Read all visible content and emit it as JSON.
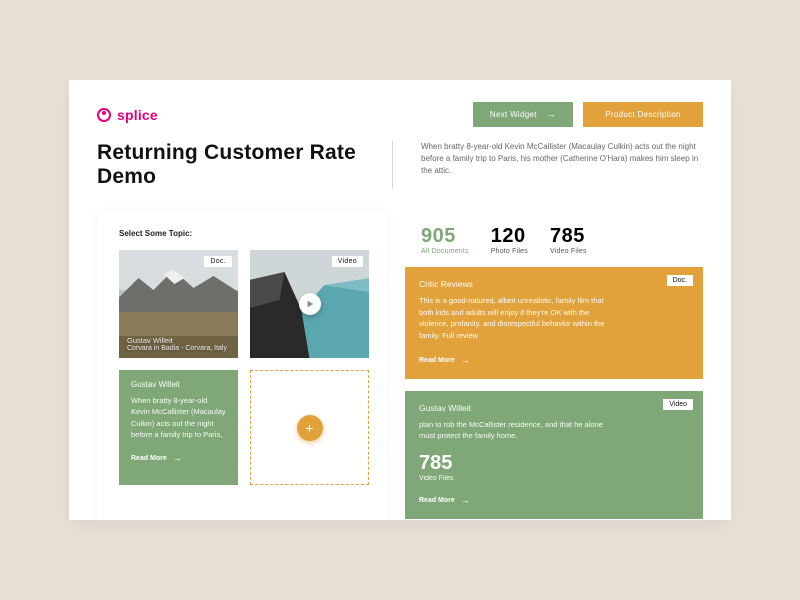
{
  "brand": {
    "name": "splice"
  },
  "toolbar": {
    "next_label": "Next Widget",
    "product_label": "Product Description"
  },
  "header": {
    "title": "Returning Customer Rate Demo",
    "subtitle": "When bratty 8-year-old Kevin McCallister (Macaulay Culkin) acts out the night before a family trip to Paris, his mother (Catherine O'Hara) makes him sleep in the attic."
  },
  "left": {
    "label": "Select Some Topic:",
    "tile1": {
      "badge": "Doc.",
      "author": "Gustav Willeit",
      "place": "Corvara in Badia - Corvara, Italy"
    },
    "tile2": {
      "badge": "Video"
    },
    "tile3": {
      "author": "Gustav Willeit",
      "desc": "When bratty 8-year-old Kevin McCallister (Macaulay Culkin) acts out the night before a family trip to Paris,",
      "readmore": "Read More"
    }
  },
  "right": {
    "stats": {
      "all_num": "905",
      "all_label": "All Documents",
      "photo_num": "120",
      "photo_label": "Photo Files",
      "video_num": "785",
      "video_label": "Video Files"
    },
    "card_orange": {
      "title": "Critic Reviews",
      "badge": "Doc.",
      "text": "This is a good-natured, albeit unrealistic, family film that both kids and adults will enjoy if they're OK with the violence, profanity, and disrespectful behavior within the family. Full review",
      "readmore": "Read More"
    },
    "card_green": {
      "title": "Gustav Willeit",
      "badge": "Video",
      "text": "plan to rob the McCallister residence, and that he alone must protect the family home.",
      "stat_num": "785",
      "stat_label": "Video Files",
      "readmore": "Read More"
    }
  }
}
